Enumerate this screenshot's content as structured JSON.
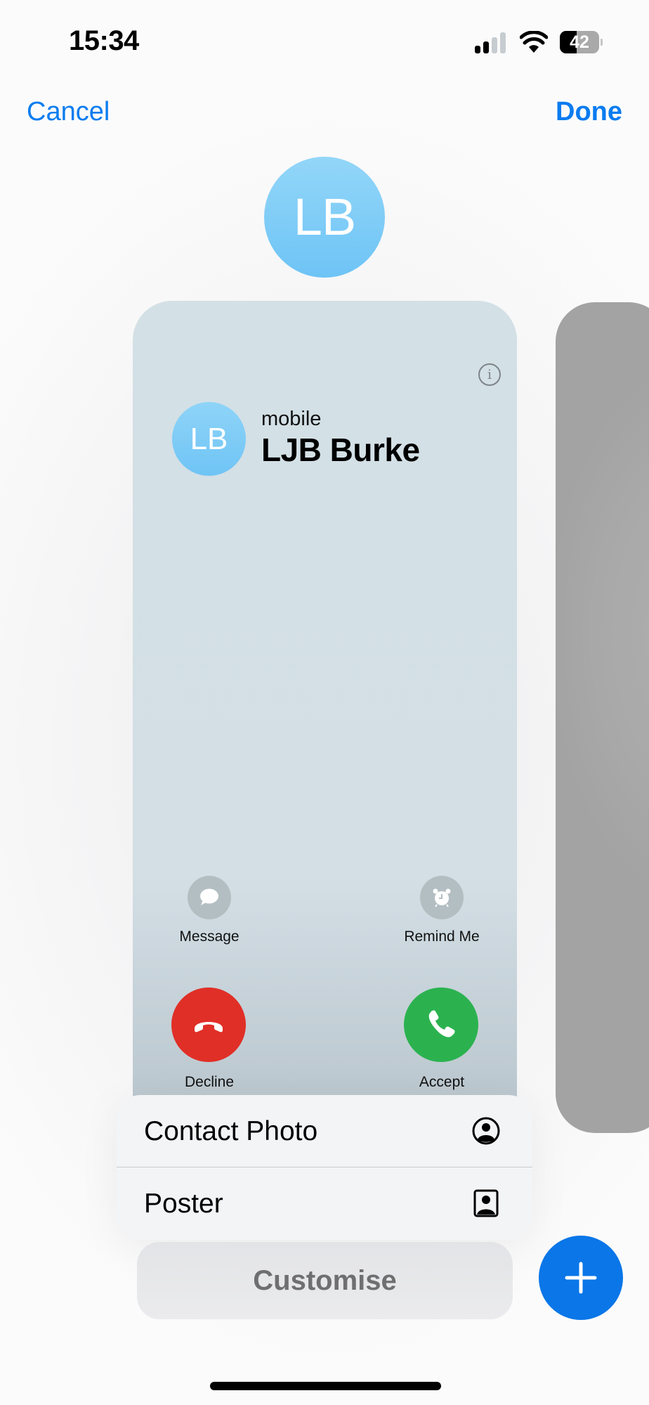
{
  "status_bar": {
    "time": "15:34",
    "battery_level": "42",
    "battery_percent": 42,
    "signal_bars_active": 2,
    "signal_bars_total": 4
  },
  "nav": {
    "cancel_label": "Cancel",
    "done_label": "Done"
  },
  "avatar": {
    "initials": "LB"
  },
  "poster": {
    "initials": "LB",
    "line_label": "mobile",
    "name": "LJB Burke",
    "info_glyph": "i",
    "actions": [
      {
        "label": "Message",
        "icon": "message-bubble-icon"
      },
      {
        "label": "Remind Me",
        "icon": "alarm-clock-icon"
      }
    ],
    "call_buttons": [
      {
        "label": "Decline",
        "icon": "phone-down-icon",
        "color": "#e02f27"
      },
      {
        "label": "Accept",
        "icon": "phone-icon",
        "color": "#2bb24f"
      }
    ]
  },
  "menu": {
    "items": [
      {
        "label": "Contact Photo",
        "icon": "person-crop-circle-icon"
      },
      {
        "label": "Poster",
        "icon": "person-crop-rectangle-icon"
      }
    ]
  },
  "customise_label": "Customise",
  "colors": {
    "accent": "#0a7cf0",
    "add_button": "#0a76e8",
    "decline": "#e02f27",
    "accept": "#2bb24f",
    "avatar": "#7fcdf7"
  }
}
